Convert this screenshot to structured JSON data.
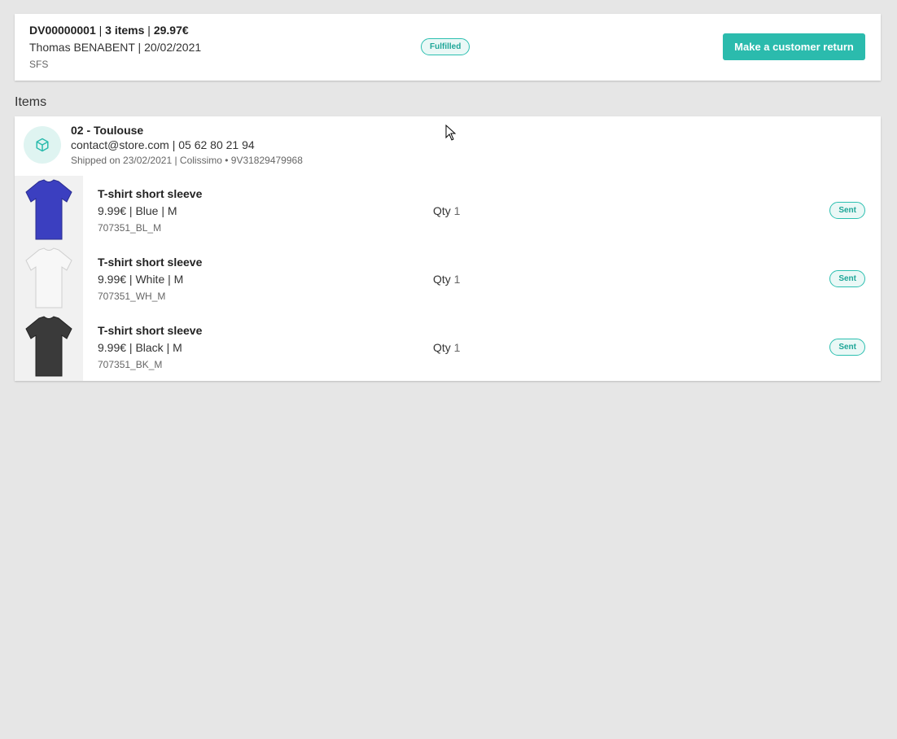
{
  "order": {
    "ref": "DV00000001",
    "items_count": "3 items",
    "total": "29.97€",
    "customer_line": "Thomas BENABENT | 20/02/2021",
    "channel": "SFS",
    "status": "Fulfilled",
    "return_button": "Make a customer return"
  },
  "section": {
    "items_title": "Items"
  },
  "store": {
    "name": "02 - Toulouse",
    "contact": "contact@store.com | 05 62 80 21 94",
    "shipping": "Shipped on 23/02/2021 | Colissimo • 9V31829479968",
    "icon": "package-icon"
  },
  "items": [
    {
      "name": "T-shirt short sleeve",
      "variant": "9.99€ | Blue | M",
      "sku": "707351_BL_M",
      "qty_label": "Qty",
      "qty": "1",
      "status": "Sent",
      "color": "#3b3fc0"
    },
    {
      "name": "T-shirt short sleeve",
      "variant": "9.99€ | White | M",
      "sku": "707351_WH_M",
      "qty_label": "Qty",
      "qty": "1",
      "status": "Sent",
      "color": "#f4f4f4"
    },
    {
      "name": "T-shirt short sleeve",
      "variant": "9.99€ | Black | M",
      "sku": "707351_BK_M",
      "qty_label": "Qty",
      "qty": "1",
      "status": "Sent",
      "color": "#3a3a3a"
    }
  ],
  "colors": {
    "accent": "#2bbbad",
    "background": "#e6e6e6"
  }
}
